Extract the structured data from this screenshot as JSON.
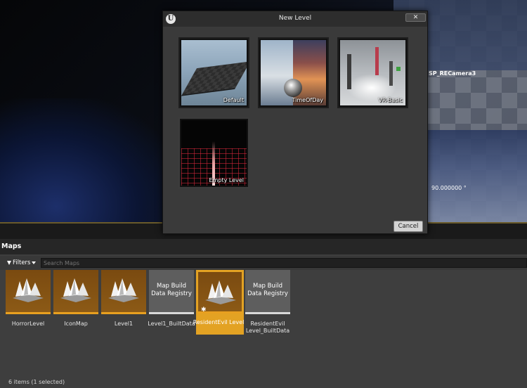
{
  "viewport": {
    "camera_label": "SP_RECamera3",
    "angle_readout": "90.000000 °"
  },
  "dialog": {
    "title": "New Level",
    "logo_text": "U",
    "close_label": "✕",
    "cancel_label": "Cancel",
    "templates": [
      {
        "label": "Default"
      },
      {
        "label": "TimeOfDay"
      },
      {
        "label": "VR-Basic"
      },
      {
        "label": "Empty Level"
      }
    ]
  },
  "content_browser": {
    "panel_title": "Maps",
    "filters_label": "Filters",
    "search_placeholder": "Search Maps",
    "assets": [
      {
        "name": "HorrorLevel",
        "type": "map",
        "selected": false
      },
      {
        "name": "IconMap",
        "type": "map",
        "selected": false
      },
      {
        "name": "Level1",
        "type": "map",
        "selected": false
      },
      {
        "name": "Level1_BuiltData",
        "type": "data",
        "tile_text": "Map Build Data Registry",
        "selected": false
      },
      {
        "name": "ResidentEvil Level",
        "type": "map",
        "selected": true
      },
      {
        "name": "ResidentEvil Level_BuiltData",
        "type": "data",
        "tile_text": "Map Build Data Registry",
        "selected": false
      }
    ],
    "status": "6 items (1 selected)"
  },
  "colors": {
    "accent_selected": "#e3a223",
    "map_bar": "#e8a020",
    "data_bar": "#d8d8d8"
  },
  "icons": [
    "unreal-logo-icon",
    "close-icon",
    "filter-icon",
    "chevron-down-icon",
    "map-peaks-icon",
    "star-icon"
  ]
}
